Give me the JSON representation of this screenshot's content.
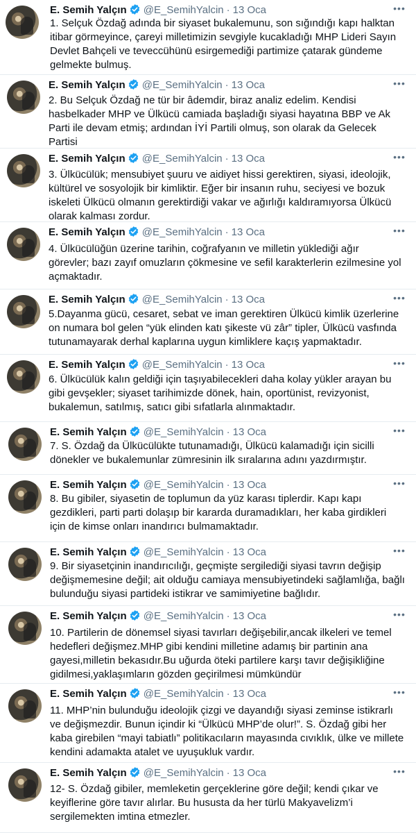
{
  "author": {
    "name": "E. Semih Yalçın",
    "handle": "@E_SemihYalcin",
    "separator": "·",
    "date": "13 Oca",
    "more": "•••",
    "verified_color": "#1da1f2"
  },
  "tweets": [
    {
      "text": "1. Selçuk Özdağ adında bir siyaset bukalemunu, son sığındığı kapı halktan\nitibar görmeyince, çareyi milletimizin sevgiyle kucakladığı MHP Lideri Sayın\nDevlet Bahçeli ve teveccühünü esirgemediği partimize çatarak gündeme\ngelmekte bulmuş."
    },
    {
      "text": "2. Bu Selçuk Özdağ ne tür bir âdemdir, biraz analiz edelim. Kendisi\nhasbelkader MHP ve Ülkücü camiada başladığı siyasi hayatına BBP ve Ak\nParti ile devam etmiş; ardından İYİ Partili olmuş, son olarak da Gelecek Partisi\nkurucular kuruluna girmiştir."
    },
    {
      "text": "3. Ülkücülük; mensubiyet şuuru ve aidiyet hissi gerektiren, siyasi, ideolojik,\nkültürel ve sosyolojik bir kimliktir. Eğer bir insanın ruhu, seciyesi ve bozuk\niskeleti Ülkücü olmanın gerektirdiği vakar ve ağırlığı kaldıramıyorsa Ülkücü\nolarak kalması zordur."
    },
    {
      "text": "4. Ülkücülüğün üzerine tarihin, coğrafyanın ve milletin yüklediği ağır\ngörevler; bazı zayıf omuzların çökmesine ve sefil karakterlerin ezilmesine yol\naçmaktadır."
    },
    {
      "text": "5.Dayanma gücü, cesaret, sebat ve iman gerektiren Ülkücü kimlik üzerlerine\non numara bol gelen “yük elinden katı şikeste vü zâr” tipler, Ülkücü vasfında\ntutunamayarak derhal kaplarına uygun kimliklere kaçış yapmaktadır."
    },
    {
      "text": "6. Ülkücülük kalın geldiği için taşıyabilecekleri daha kolay yükler arayan bu\ngibi gevşekler; siyaset tarihimizde dönek, hain, oportünist, revizyonist,\nbukalemun, satılmış, satıcı gibi sıfatlarla alınmaktadır."
    },
    {
      "text": "7. S. Özdağ da Ülkücülükte tutunamadığı, Ülkücü kalamadığı için sicilli\ndönekler ve bukalemunlar zümresinin ilk sıralarına adını yazdırmıştır."
    },
    {
      "text": "8. Bu gibiler, siyasetin de toplumun da yüz karası tiplerdir. Kapı kapı\ngezdikleri, parti parti dolaşıp bir kararda duramadıkları, her kaba girdikleri\niçin de kimse onları inandırıcı bulmamaktadır."
    },
    {
      "text": "9. Bir siyasetçinin inandırıcılığı, geçmişte sergilediği siyasi tavrın değişip\ndeğişmemesine değil; ait olduğu camiaya mensubiyetindeki sağlamlığa, bağlı\nbulunduğu siyasi partideki istikrar ve samimiyetine bağlıdır."
    },
    {
      "text": "10. Partilerin de dönemsel siyasi tavırları değişebilir,ancak ilkeleri ve temel\nhedefleri değişmez.MHP gibi kendini milletine adamış bir partinin ana\ngayesi,milletin bekasıdır.Bu uğurda öteki partilere karşı tavır değişikliğine\ngidilmesi,yaklaşımların gözden geçirilmesi mümkündür"
    },
    {
      "text": "11. MHP’nin bulunduğu ideolojik çizgi ve dayandığı siyasi zeminse istikrarlı\nve değişmezdir. Bunun içindir ki “Ülkücü MHP’de olur!”. S. Özdağ gibi her\nkaba girebilen “mayi tabiatlı” politikacıların mayasında cıvıklık, ülke ve millete\nkendini adamakta atalet ve uyuşukluk vardır."
    },
    {
      "text": "12- S. Özdağ gibiler, memleketin gerçeklerine göre değil; kendi çıkar ve\nkeyiflerine göre tavır alırlar. Bu hususta da her türlü Makyavelizm’i\nsergilemekten imtina etmezler."
    }
  ]
}
